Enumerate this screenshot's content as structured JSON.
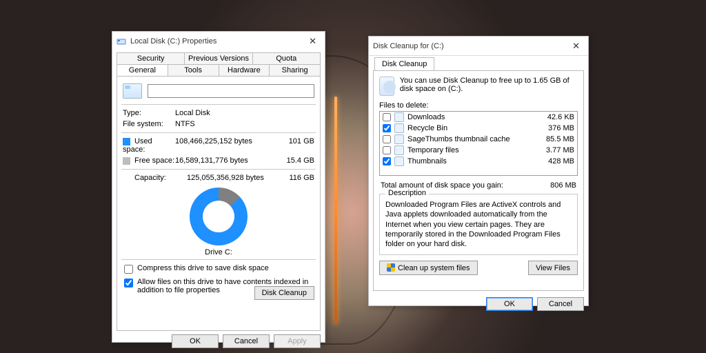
{
  "props": {
    "title": "Local Disk (C:) Properties",
    "tabs_row1": [
      "Security",
      "Previous Versions",
      "Quota"
    ],
    "tabs_row2": [
      "General",
      "Tools",
      "Hardware",
      "Sharing"
    ],
    "selected_tab": "General",
    "drive_name_value": "",
    "type_label": "Type:",
    "type_value": "Local Disk",
    "fs_label": "File system:",
    "fs_value": "NTFS",
    "used_label": "Used space:",
    "used_bytes": "108,466,225,152 bytes",
    "used_human": "101 GB",
    "free_label": "Free space:",
    "free_bytes": "16,589,131,776 bytes",
    "free_human": "15.4 GB",
    "cap_label": "Capacity:",
    "cap_bytes": "125,055,356,928 bytes",
    "cap_human": "116 GB",
    "drive_caption": "Drive C:",
    "disk_cleanup_btn": "Disk Cleanup",
    "chk_compress": "Compress this drive to save disk space",
    "chk_index": "Allow files on this drive to have contents indexed in addition to file properties",
    "chk_compress_checked": false,
    "chk_index_checked": true,
    "ok": "OK",
    "cancel": "Cancel",
    "apply": "Apply"
  },
  "dc": {
    "title": "Disk Cleanup for  (C:)",
    "tab": "Disk Cleanup",
    "info": "You can use Disk Cleanup to free up to 1.65 GB of disk space on  (C:).",
    "files_label": "Files to delete:",
    "items": [
      {
        "checked": false,
        "name": "Downloads",
        "size": "42.6 KB"
      },
      {
        "checked": true,
        "name": "Recycle Bin",
        "size": "376 MB"
      },
      {
        "checked": false,
        "name": "SageThumbs thumbnail cache",
        "size": "85.5 MB"
      },
      {
        "checked": false,
        "name": "Temporary files",
        "size": "3.77 MB"
      },
      {
        "checked": true,
        "name": "Thumbnails",
        "size": "428 MB"
      }
    ],
    "total_label": "Total amount of disk space you gain:",
    "total_value": "806 MB",
    "desc_legend": "Description",
    "desc_text": "Downloaded Program Files are ActiveX controls and Java applets downloaded automatically from the Internet when you view certain pages. They are temporarily stored in the Downloaded Program Files folder on your hard disk.",
    "cleanup_sys": "Clean up system files",
    "view_files": "View Files",
    "ok": "OK",
    "cancel": "Cancel"
  }
}
